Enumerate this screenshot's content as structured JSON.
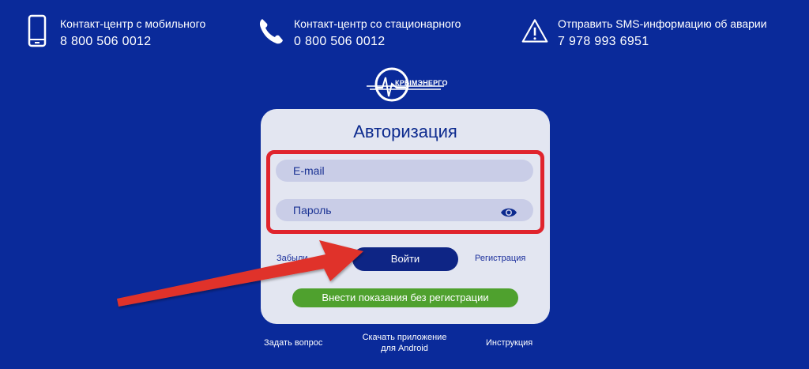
{
  "contacts": [
    {
      "label": "Контакт-центр с мобильного",
      "number": "8 800 506 0012",
      "icon": "mobile-phone-icon"
    },
    {
      "label": "Контакт-центр со стационарного",
      "number": "0 800 506 0012",
      "icon": "handset-icon"
    },
    {
      "label": "Отправить SMS-информацию об аварии",
      "number": "7 978 993 6951",
      "icon": "warning-triangle-icon"
    }
  ],
  "logo": {
    "text": "КРЫМЭНЕРГО"
  },
  "auth": {
    "title": "Авторизация",
    "email_placeholder": "E-mail",
    "password_placeholder": "Пароль",
    "forgot_link": "Забыли",
    "login_button": "Войти",
    "register_link": "Регистрация",
    "noreg_button": "Внести показания без регистрации"
  },
  "footer": {
    "ask": "Задать вопрос",
    "app_line1": "Скачать приложение",
    "app_line2": "для Android",
    "manual": "Инструкция"
  },
  "colors": {
    "background": "#0a2a9a",
    "card": "#e3e6f1",
    "field": "#c9cde7",
    "primary_button": "#0e2585",
    "green_button": "#4fa12e",
    "highlight": "#e0242d"
  }
}
